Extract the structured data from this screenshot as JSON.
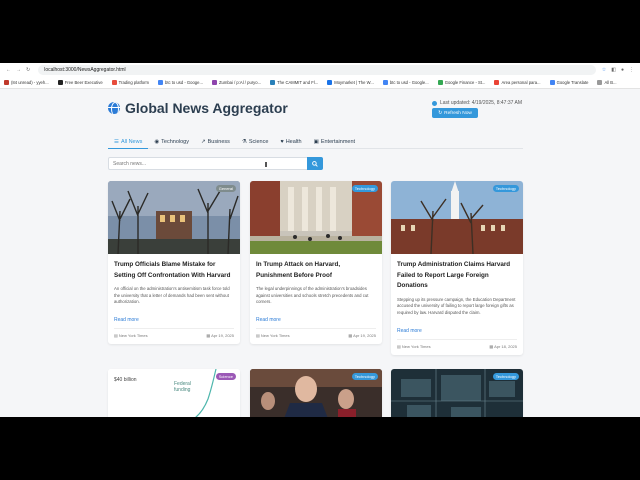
{
  "browser": {
    "url": "localhost:3000/NewsAggregator.html",
    "bookmarks": [
      "(84 unread) - yyeh...",
      "Free Beer Executive",
      "Trading platform",
      "btc to usd - Googe...",
      "Zumbai / p:Al / puryo...",
      "The CAMMIT and Fl...",
      "Moymarket | The W...",
      "btc to usd - Google...",
      "Google Finance - St...",
      "Area personal para...",
      "Google Translate",
      "All B..."
    ]
  },
  "header": {
    "title": "Global News Aggregator",
    "updated": "Last updated: 4/19/2025, 8:47:37 AM",
    "refresh_label": "Refresh Now"
  },
  "tabs": [
    {
      "label": "All News"
    },
    {
      "label": "Technology"
    },
    {
      "label": "Business"
    },
    {
      "label": "Science"
    },
    {
      "label": "Health"
    },
    {
      "label": "Entertainment"
    }
  ],
  "search": {
    "placeholder": "Search news..."
  },
  "articles": [
    {
      "category": "General",
      "title": "Trump Officials Blame Mistake for Setting Off Confrontation With Harvard",
      "summary": "An official on the administration's antisemitism task force told the university that a letter of demands had been sent without authorization.",
      "read_more": "Read more",
      "source": "New York Times",
      "date": "Apr 19, 2025"
    },
    {
      "category": "Technology",
      "title": "In Trump Attack on Harvard, Punishment Before Proof",
      "summary": "The legal underpinnings of the administration's broadsides against universities and schools stretch precedents and cut corners.",
      "read_more": "Read more",
      "source": "New York Times",
      "date": "Apr 19, 2025"
    },
    {
      "category": "Technology",
      "title": "Trump Administration Claims Harvard Failed to Report Large Foreign Donations",
      "summary": "Stepping up its pressure campaign, the Education Department accused the university of failing to report large foreign gifts as required by law. Harvard disputed the claim.",
      "read_more": "Read more",
      "source": "New York Times",
      "date": "Apr 18, 2025"
    },
    {
      "category": "Science",
      "chart_label_1": "$40 billion",
      "chart_label_2": "Federal funding"
    },
    {
      "category": "Technology"
    },
    {
      "category": "Technology"
    }
  ]
}
